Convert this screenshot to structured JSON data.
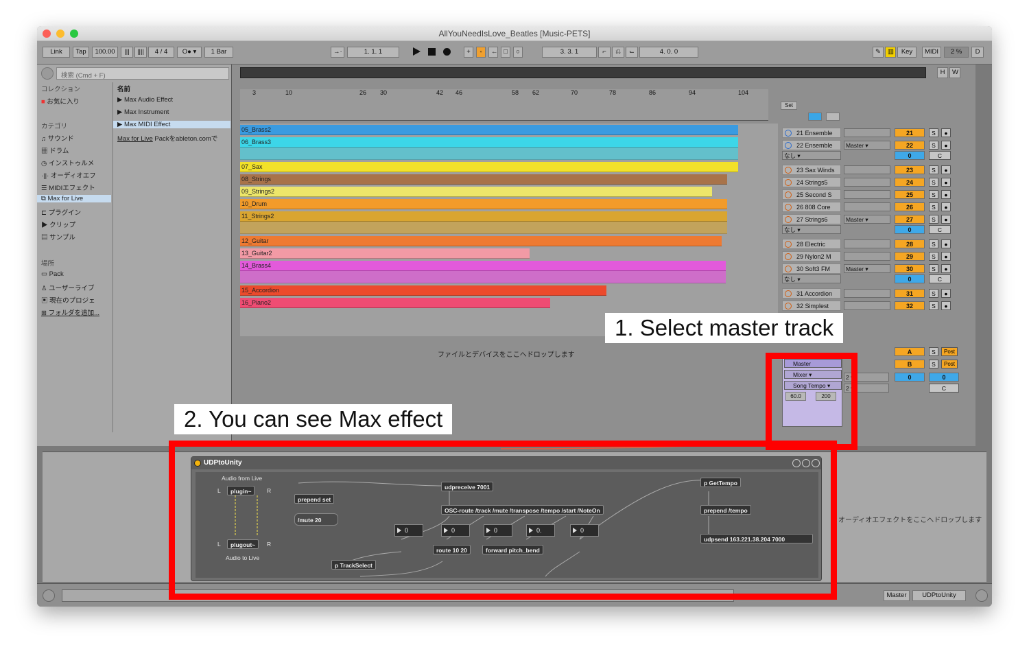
{
  "window": {
    "title": "AllYouNeedIsLove_Beatles  [Music-PETS]"
  },
  "toolbar": {
    "link": "Link",
    "tap": "Tap",
    "tempo": "100.00",
    "time_sig": "4 / 4",
    "quantize": "1 Bar",
    "arrangement_pos": "1.  1.  1",
    "loop_start": "3.  3.  1",
    "loop_length": "4.  0.  0",
    "key": "Key",
    "midi": "MIDI",
    "cpu": "2 %",
    "d": "D",
    "h": "H",
    "w": "W"
  },
  "browser": {
    "search_placeholder": "検索 (Cmd + F)",
    "collections_header": "コレクション",
    "favorites": "お気に入り",
    "categories_header": "カテゴリ",
    "categories": [
      "サウンド",
      "ドラム",
      "インストゥルメ",
      "オーディオエフ",
      "MIDIエフェクト",
      "Max for Live",
      "プラグイン",
      "クリップ",
      "サンプル"
    ],
    "places_header": "場所",
    "places": [
      "Pack",
      "ユーザーライブ",
      "現在のプロジェ",
      "フォルダを追加..."
    ],
    "name_header": "名前",
    "items": [
      "Max Audio Effect",
      "Max Instrument",
      "Max MIDI Effect"
    ],
    "pack_link": "Max for Live",
    "pack_text": "Packをableton.comで"
  },
  "arrangement": {
    "ruler_marks": [
      "3",
      "10",
      "26",
      "30",
      "42",
      "46",
      "58",
      "62",
      "70",
      "78",
      "86",
      "94",
      "104"
    ],
    "set_label": "Set",
    "clips": [
      {
        "name": "05_Brass2",
        "color": "#3a9be0"
      },
      {
        "name": "06_Brass3",
        "color": "#3cd6e8"
      },
      {
        "name": "07_Sax",
        "color": "#f2e12a"
      },
      {
        "name": "08_Strings",
        "color": "#a8734a"
      },
      {
        "name": "09_Strings2",
        "color": "#ede66a"
      },
      {
        "name": "10_Drum",
        "color": "#f29b2a"
      },
      {
        "name": "11_Strings2",
        "color": "#d9a530"
      },
      {
        "name": "12_Guitar",
        "color": "#ee7a32"
      },
      {
        "name": "13_Guitar2",
        "color": "#f29aa5"
      },
      {
        "name": "14_Brass4",
        "color": "#e25adb"
      },
      {
        "name": "15_Accordion",
        "color": "#ec4a2c"
      },
      {
        "name": "16_Piano2",
        "color": "#ef4c73"
      }
    ],
    "drop_message": "ファイルとデバイスをここへドロップします"
  },
  "tracks": [
    {
      "name": "21 Ensemble",
      "num": "21"
    },
    {
      "name": "22 Ensemble",
      "num": "22",
      "route": "Master",
      "sub": "なし",
      "sub_num": "0"
    },
    {
      "name": "23 Sax Winds",
      "num": "23"
    },
    {
      "name": "24 Strings5",
      "num": "24"
    },
    {
      "name": "25 Second S",
      "num": "25"
    },
    {
      "name": "26 808 Core",
      "num": "26"
    },
    {
      "name": "27 Strings6",
      "num": "27",
      "route": "Master",
      "sub": "なし",
      "sub_num": "0"
    },
    {
      "name": "28 Electric",
      "num": "28"
    },
    {
      "name": "29 Nylon2 M",
      "num": "29"
    },
    {
      "name": "30 Soft3 FM",
      "num": "30",
      "route": "Master",
      "sub": "なし",
      "sub_num": "0"
    },
    {
      "name": "31 Accordion",
      "num": "31"
    },
    {
      "name": "32 Simplest",
      "num": "32"
    }
  ],
  "returns": [
    {
      "label": "A",
      "post": "Post"
    },
    {
      "label": "B",
      "post": "Post"
    }
  ],
  "master": {
    "name": "Master",
    "mixer": "Mixer",
    "param": "Song Tempo",
    "min": "60.0",
    "max": "200",
    "vol": "0",
    "pan": "C",
    "out": "0",
    "ch": "2",
    "s_label": "S",
    "c_label": "C"
  },
  "max_device": {
    "title": "UDPtoUnity",
    "audio_from": "Audio from Live",
    "audio_to": "Audio to Live",
    "plugin": "plugin~",
    "plugout": "plugout~",
    "L": "L",
    "R": "R",
    "objects": {
      "prepend_set": "prepend set",
      "mute20": "/mute 20",
      "udpreceive": "udpreceive 7001",
      "osc_route": "OSC-route /track /mute /transpose /tempo /start /NoteOn",
      "route": "route 10 20",
      "forward": "forward pitch_bend",
      "trackselect": "p TrackSelect",
      "gettempo": "p GetTempo",
      "prepend_tempo": "prepend /tempo",
      "udpsend": "udpsend 163.221.38.204 7000"
    },
    "numbers": [
      "0",
      "0",
      "0",
      "0.",
      "0"
    ]
  },
  "device_drop": "オーディオエフェクトをここへドロップします",
  "status": {
    "track": "Master",
    "device": "UDPtoUnity"
  },
  "callouts": {
    "step1": "1. Select master track",
    "step2": "2. You can see Max effect"
  },
  "colors": {
    "highlight": "#ff0000",
    "accent": "#f5a623",
    "master": "#c5b9e6"
  }
}
